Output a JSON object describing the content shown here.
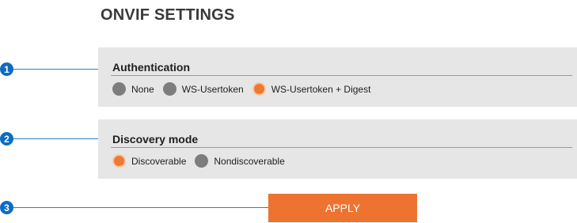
{
  "page": {
    "title": "ONVIF SETTINGS"
  },
  "authentication": {
    "title": "Authentication",
    "options": [
      {
        "label": "None",
        "selected": false
      },
      {
        "label": "WS-Usertoken",
        "selected": false
      },
      {
        "label": "WS-Usertoken + Digest",
        "selected": true
      }
    ]
  },
  "discovery": {
    "title": "Discovery mode",
    "options": [
      {
        "label": "Discoverable",
        "selected": true
      },
      {
        "label": "Nondiscoverable",
        "selected": false
      }
    ]
  },
  "apply": {
    "label": "APPLY"
  },
  "callouts": [
    "1",
    "2",
    "3"
  ],
  "colors": {
    "accent": "#ee7330",
    "callout": "#0d6cc2",
    "panel": "#e6e6e6",
    "radio_off": "#7d7d7d"
  }
}
